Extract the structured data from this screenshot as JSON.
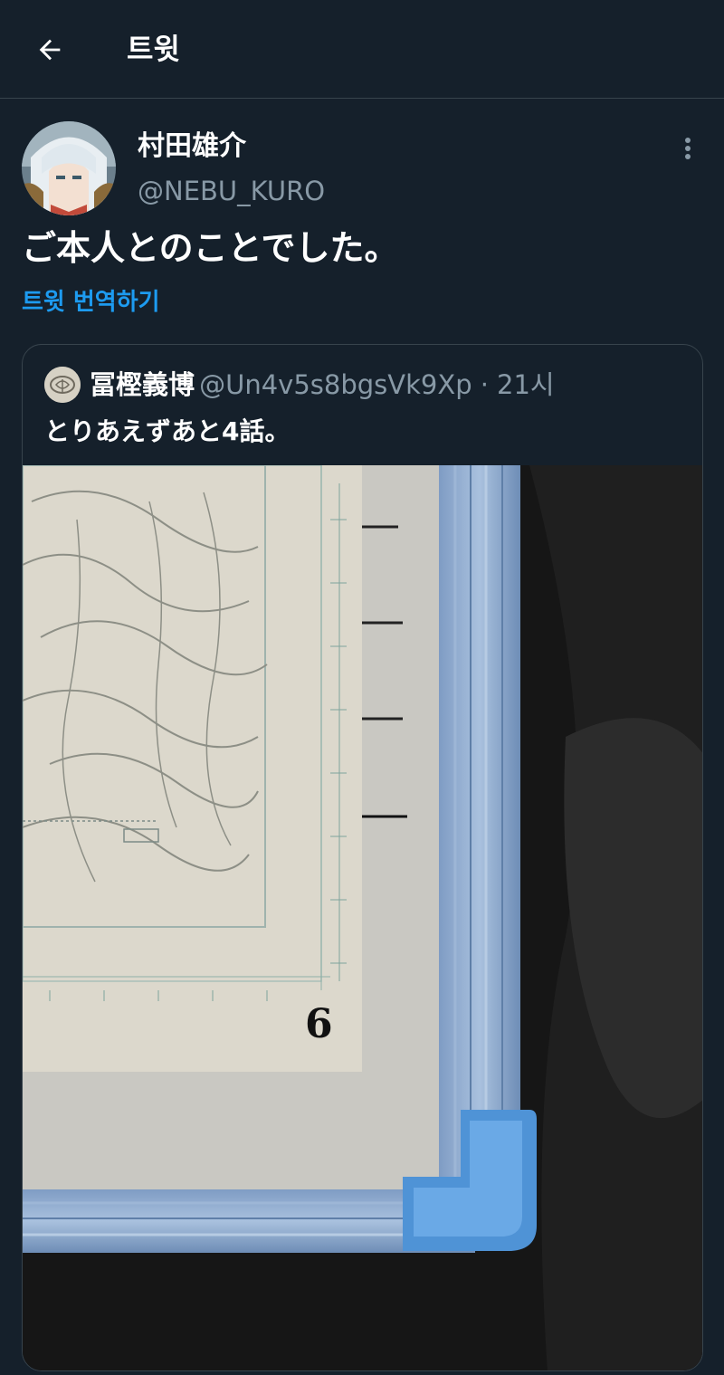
{
  "header": {
    "title": "트윗"
  },
  "tweet": {
    "author_name": "村田雄介",
    "author_handle": "@NEBU_KURO",
    "text": "ご本人とのことでした。",
    "translate_label": "트윗 번역하기"
  },
  "quote": {
    "author_name": "冨樫義博",
    "author_handle": "@Un4v5s8bgsVk9Xp",
    "separator": "·",
    "time": "21시",
    "text": "とりあえずあと4話。",
    "photo_number": "6"
  },
  "colors": {
    "background": "#15202b",
    "border": "#38444d",
    "secondary_text": "#8899a6",
    "link": "#1d9bf0"
  },
  "icons": {
    "back": "arrow-left-icon",
    "more": "more-vertical-icon"
  }
}
